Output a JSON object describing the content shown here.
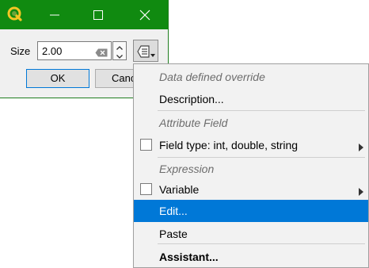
{
  "dialog": {
    "size_label": "Size",
    "size_value": "2.00",
    "ok_label": "OK",
    "cancel_label": "Cancel",
    "titlebar_color": "#108a10",
    "icons": {
      "app": "qgis-logo-icon",
      "minimize": "minimize-icon",
      "maximize": "maximize-icon",
      "close": "close-icon",
      "clear": "clear-input-icon",
      "spin_up": "chevron-up-icon",
      "spin_down": "chevron-down-icon",
      "data_defined": "data-defined-override-icon"
    }
  },
  "menu": {
    "highlight_color": "#0078d7",
    "items": [
      {
        "label": "Data defined override",
        "kind": "header"
      },
      {
        "label": "Description...",
        "kind": "item"
      },
      {
        "label": "Attribute Field",
        "kind": "header"
      },
      {
        "label": "Field type: int, double, string",
        "kind": "submenu",
        "checked": false
      },
      {
        "label": "Expression",
        "kind": "header"
      },
      {
        "label": "Variable",
        "kind": "submenu",
        "checked": false
      },
      {
        "label": "Edit...",
        "kind": "item",
        "highlighted": true
      },
      {
        "label": "Paste",
        "kind": "item"
      },
      {
        "label": "Assistant...",
        "kind": "item",
        "bold": true
      }
    ]
  }
}
